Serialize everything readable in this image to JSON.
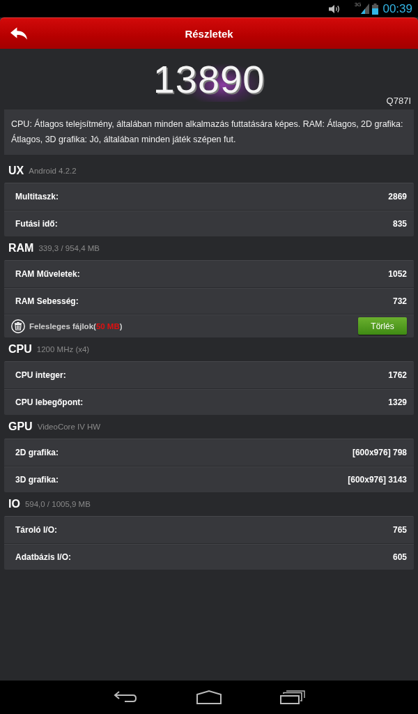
{
  "status_bar": {
    "network_type": "3G",
    "time": "00:39"
  },
  "app_bar": {
    "title": "Részletek"
  },
  "score": {
    "value": "13890",
    "device_model": "Q787I"
  },
  "description": "CPU: Átlagos telejsítmény, általában minden alkalmazás futtatására képes. RAM: Átlagos, 2D grafika: Átlagos, 3D grafika: Jó, általában minden játék szépen fut.",
  "sections": [
    {
      "title": "UX",
      "subtitle": "Android 4.2.2",
      "rows": [
        {
          "kind": "score",
          "label": "Multitaszk:",
          "value": "2869"
        },
        {
          "kind": "score",
          "label": "Futási idő:",
          "value": "835"
        }
      ]
    },
    {
      "title": "RAM",
      "subtitle": "339,3 / 954,4 MB",
      "rows": [
        {
          "kind": "score",
          "label": "RAM Műveletek:",
          "value": "1052"
        },
        {
          "kind": "score",
          "label": "RAM Sebesség:",
          "value": "732"
        },
        {
          "kind": "cleanup",
          "label_before": "Felesleges fájlok(",
          "amount": "50 MB",
          "label_after": ")",
          "button": "Törlés"
        }
      ]
    },
    {
      "title": "CPU",
      "subtitle": "1200 MHz (x4)",
      "rows": [
        {
          "kind": "score",
          "label": "CPU integer:",
          "value": "1762"
        },
        {
          "kind": "score",
          "label": "CPU lebegőpont:",
          "value": "1329"
        }
      ]
    },
    {
      "title": "GPU",
      "subtitle": "VideoCore IV HW",
      "rows": [
        {
          "kind": "score",
          "label": "2D grafika:",
          "value": "[600x976] 798"
        },
        {
          "kind": "score",
          "label": "3D grafika:",
          "value": "[600x976] 3143"
        }
      ]
    },
    {
      "title": "IO",
      "subtitle": "594,0 / 1005,9 MB",
      "rows": [
        {
          "kind": "score",
          "label": "Tároló I/O:",
          "value": "765"
        },
        {
          "kind": "score",
          "label": "Adatbázis I/O:",
          "value": "605"
        }
      ]
    }
  ]
}
